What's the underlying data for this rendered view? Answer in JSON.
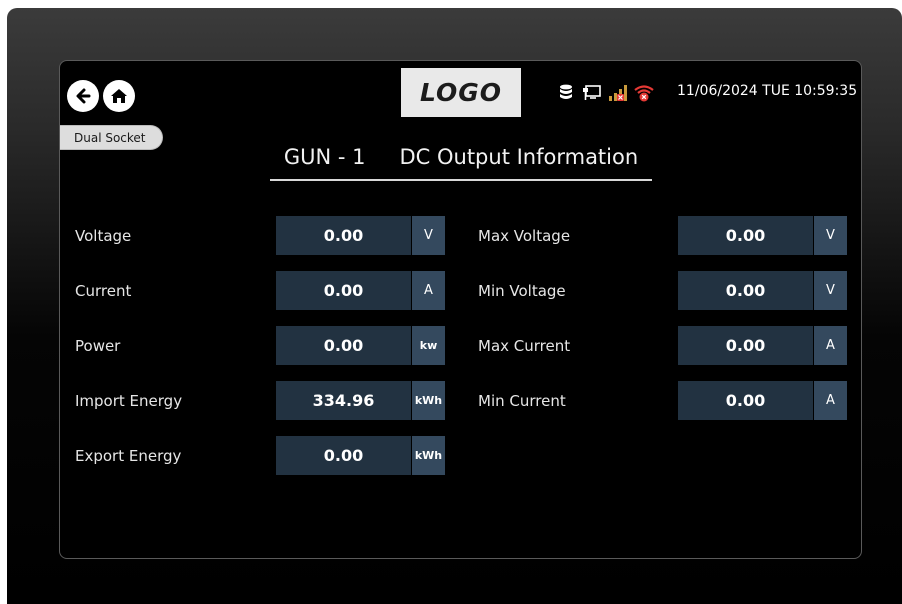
{
  "header": {
    "logo_text": "LOGO",
    "datetime": "11/06/2024 TUE 10:59:35",
    "mode_tab": "Dual Socket"
  },
  "icons": {
    "back": "arrow-left-circle-icon",
    "home": "home-icon",
    "database": "database-icon",
    "network": "network-plug-icon",
    "signal": "signal-bars-error-icon",
    "wifi": "wifi-error-icon"
  },
  "title": {
    "gun": "GUN - 1",
    "section": "DC Output Information"
  },
  "left_params": [
    {
      "label": "Voltage",
      "value": "0.00",
      "unit": "V"
    },
    {
      "label": "Current",
      "value": "0.00",
      "unit": "A"
    },
    {
      "label": "Power",
      "value": "0.00",
      "unit": "kw"
    },
    {
      "label": "Import Energy",
      "value": "334.96",
      "unit": "kWh"
    },
    {
      "label": "Export Energy",
      "value": "0.00",
      "unit": "kWh"
    }
  ],
  "right_params": [
    {
      "label": "Max Voltage",
      "value": "0.00",
      "unit": "V"
    },
    {
      "label": "Min Voltage",
      "value": "0.00",
      "unit": "V"
    },
    {
      "label": "Max Current",
      "value": "0.00",
      "unit": "A"
    },
    {
      "label": "Min Current",
      "value": "0.00",
      "unit": "A"
    }
  ],
  "colors": {
    "value_bg": "#223241",
    "unit_bg": "#34495e",
    "alert_red": "#e53935"
  }
}
